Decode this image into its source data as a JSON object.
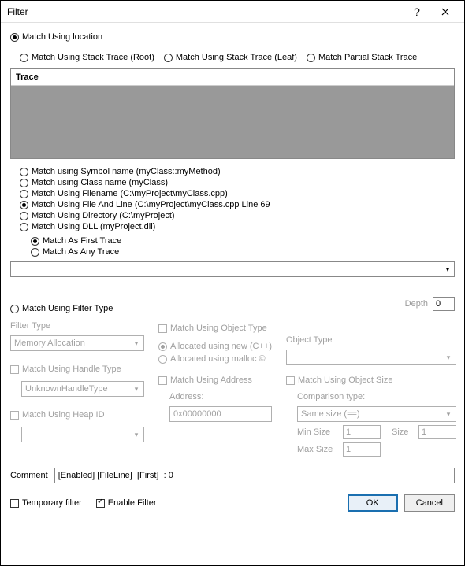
{
  "window": {
    "title": "Filter"
  },
  "mainRadios": {
    "location": "Match Using location",
    "root": "Match Using Stack Trace (Root)",
    "leaf": "Match Using Stack Trace (Leaf)",
    "partial": "Match Partial Stack Trace",
    "filterType": "Match Using Filter Type"
  },
  "trace": {
    "header": "Trace"
  },
  "matchBy": {
    "symbol": "Match using Symbol name (myClass::myMethod)",
    "className": "Match using Class name (myClass)",
    "filename": "Match Using Filename (C:\\myProject\\myClass.cpp)",
    "fileLine": "Match Using File And Line (C:\\myProject\\myClass.cpp Line 69",
    "directory": "Match Using Directory (C:\\myProject)",
    "dll": "Match Using DLL (myProject.dll)"
  },
  "tracePos": {
    "first": "Match As First Trace",
    "any": "Match As Any Trace"
  },
  "depth": {
    "label": "Depth",
    "value": "0"
  },
  "filterType": {
    "label": "Filter Type",
    "value": "Memory Allocation",
    "handleCheck": "Match Using Handle Type",
    "handleValue": "UnknownHandleType",
    "heapCheck": "Match Using Heap ID"
  },
  "objectOpts": {
    "checkObjType": "Match Using Object Type",
    "allocNew": "Allocated using new (C++)",
    "allocMalloc": "Allocated using malloc ©",
    "checkAddress": "Match Using Address",
    "addressLabel": "Address:",
    "addressValue": "0x00000000",
    "objTypeLabel": "Object Type",
    "checkObjSize": "Match Using Object Size",
    "compLabel": "Comparison type:",
    "compValue": "Same size (==)",
    "minSizeLabel": "Min Size",
    "minSizeValue": "1",
    "sizeLabel": "Size",
    "sizeValue": "1",
    "maxSizeLabel": "Max Size",
    "maxSizeValue": "1"
  },
  "comment": {
    "label": "Comment",
    "value": "[Enabled] [FileLine]  [First]  : 0"
  },
  "footer": {
    "temp": "Temporary filter",
    "enable": "Enable Filter",
    "ok": "OK",
    "cancel": "Cancel"
  }
}
